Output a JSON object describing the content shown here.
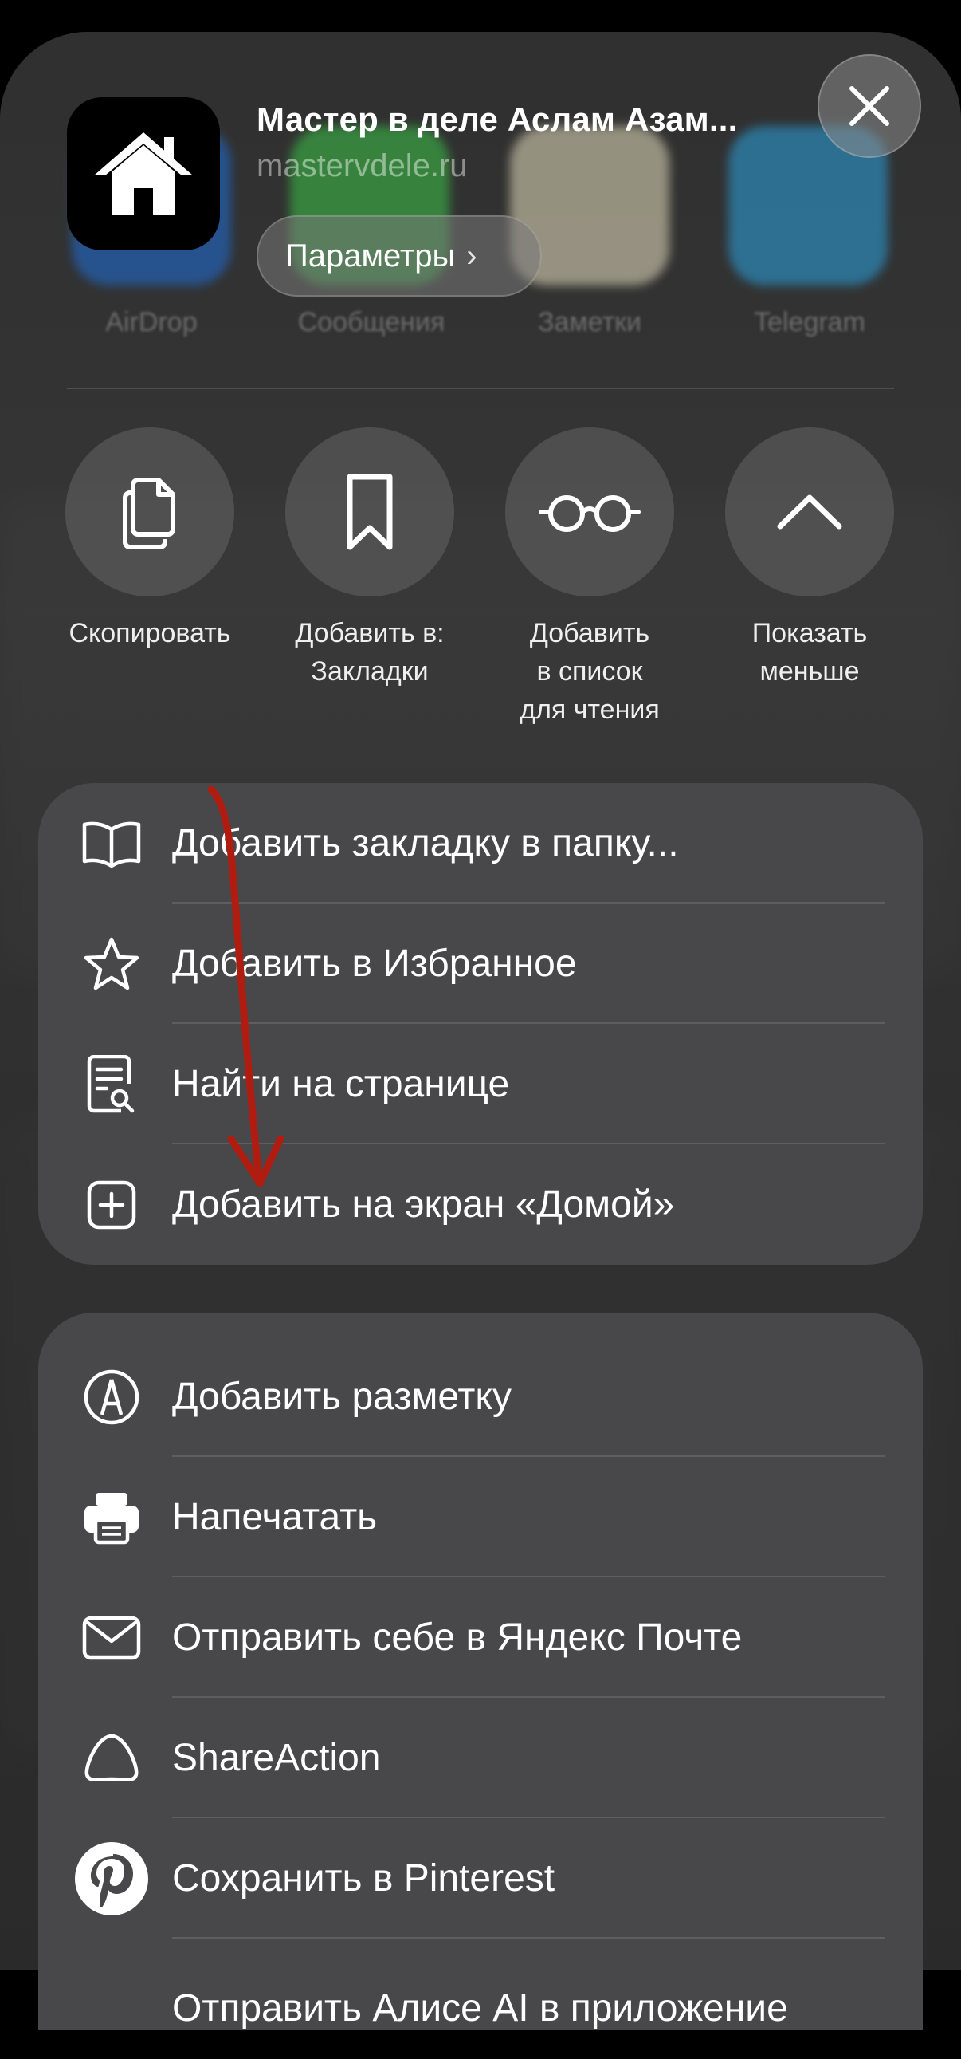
{
  "header": {
    "title": "Мастер в деле Аслам Азам...",
    "url": "mastervdele.ru",
    "params_label": "Параметры",
    "params_chevron": "›",
    "close_icon": "close-icon"
  },
  "background_targets": [
    "AirDrop",
    "Сообщения",
    "Заметки",
    "Telegram"
  ],
  "quick_actions": [
    {
      "label": "Скопировать",
      "icon": "copy-icon"
    },
    {
      "label": "Добавить в:\nЗакладки",
      "icon": "bookmark-icon"
    },
    {
      "label": "Добавить\nв список\nдля чтения",
      "icon": "glasses-icon"
    },
    {
      "label": "Показать\nменьше",
      "icon": "chevron-up-icon"
    }
  ],
  "group1": [
    {
      "label": "Добавить закладку в папку...",
      "icon": "open-book-icon"
    },
    {
      "label": "Добавить в Избранное",
      "icon": "star-icon"
    },
    {
      "label": "Найти на странице",
      "icon": "find-on-page-icon"
    },
    {
      "label": "Добавить на экран «Домой»",
      "icon": "add-square-icon"
    }
  ],
  "group2": [
    {
      "label": "Добавить разметку",
      "icon": "markup-icon"
    },
    {
      "label": "Напечатать",
      "icon": "printer-icon"
    },
    {
      "label": "Отправить себе в Яндекс Почте",
      "icon": "mail-icon"
    },
    {
      "label": "ShareAction",
      "icon": "alice-icon"
    },
    {
      "label": "Сохранить в Pinterest",
      "icon": "pinterest-icon"
    },
    {
      "label": "Отправить Алисе AI в приложение",
      "icon": "more-icon"
    }
  ],
  "colors": {
    "group_bg": "#48484a",
    "annotation_arrow": "#b01c10",
    "background": "#000000"
  }
}
